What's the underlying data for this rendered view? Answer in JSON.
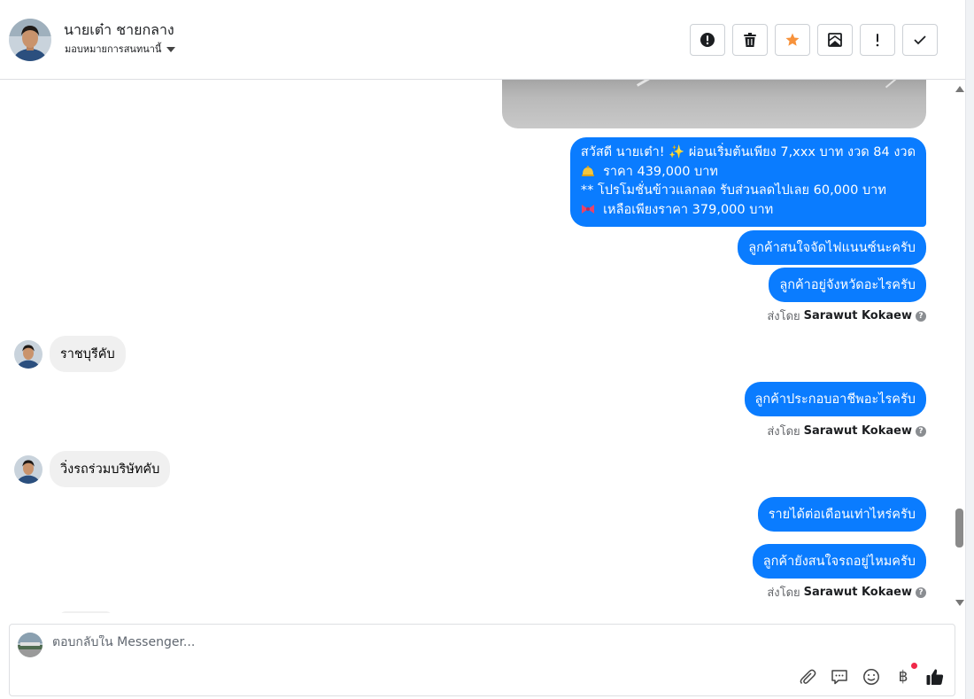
{
  "header": {
    "contact_name": "นายเต๋า ชายกลาง",
    "assign_label": "มอบหมายการสนทนานี้",
    "actions": [
      {
        "icon": "alert-circle-icon",
        "name": "mark-spam-button"
      },
      {
        "icon": "trash-icon",
        "name": "delete-button"
      },
      {
        "icon": "star-icon",
        "name": "star-button"
      },
      {
        "icon": "mark-unread-icon",
        "name": "mark-unread-button"
      },
      {
        "icon": "exclamation-icon",
        "name": "follow-up-button"
      },
      {
        "icon": "checkmark-icon",
        "name": "mark-done-button"
      }
    ]
  },
  "colors": {
    "outgoing_bubble": "#0a7cff",
    "incoming_bubble": "#f0f0f0",
    "star": "#f7923b",
    "notification_dot": "#f02849"
  },
  "messages": {
    "promo": {
      "line1_text": "สวัสดี นายเต๋า! ✨  ผ่อนเริ่มต้นเพียง 7,xxx บาท งวด 84 งวด",
      "line2_text": "ราคา 439,000 บาท",
      "line2_icon": "bell-icon",
      "line3_text": "** โปรโมชั่นข้าวแลกลด รับส่วนลดไปเลย 60,000 บาท",
      "line4_text": "เหลือเพียงราคา 379,000 บาท",
      "line4_icon": "ribbon-icon"
    },
    "out1": "ลูกค้าสนใจจัดไฟแนนซ์นะครับ",
    "out2": "ลูกค้าอยู่จังหวัดอะไรครับ",
    "in1": "ราชบุรีคับ",
    "out3": "ลูกค้าประกอบอาชีพอะไรครับ",
    "in2": "วิ่งรถร่วมบริษัทคับ",
    "out4": "รายได้ต่อเดือนเท่าไหร่ครับ",
    "out5": "ลูกค้ายังสนใจรถอยู่ไหมครับ",
    "sent_by_prefix": "ส่งโดย",
    "sent_by_name": "Sarawut Kokaew"
  },
  "reply": {
    "placeholder": "ตอบกลับใน Messenger...",
    "tools": [
      "paperclip-icon",
      "saved-reply-icon",
      "emoji-icon",
      "baht-icon",
      "thumbs-up-icon"
    ],
    "baht_symbol": "฿"
  }
}
